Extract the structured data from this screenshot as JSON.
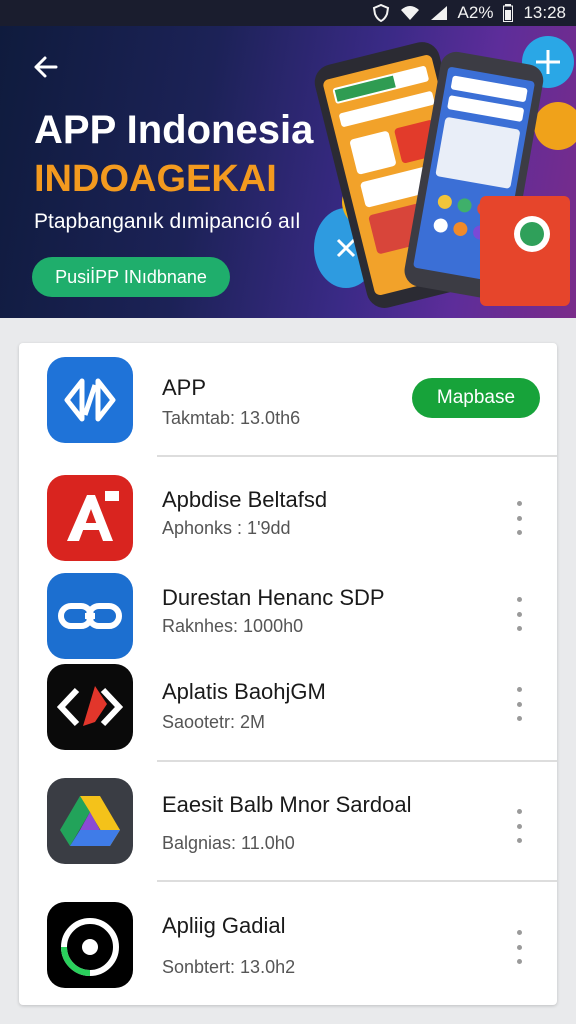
{
  "status_bar": {
    "battery_percent": "A2%",
    "time": "13:28",
    "icons": [
      "shield-icon",
      "wifi-icon",
      "signal-icon",
      "battery-icon"
    ]
  },
  "banner": {
    "title": "APP Indonesia",
    "subtitle": "INDOAGEKAI",
    "description": "Ptapbanganık dımipancıó aıl",
    "button_label": "PusiİPP INıdbnane",
    "colors": {
      "title": "#ffffff",
      "subtitle": "#f39a1f",
      "button": "#1fae6c"
    }
  },
  "apps": [
    {
      "name": "APP",
      "meta": "Takmtab: 13.0th6",
      "icon": "app-logo-icon",
      "action": "Mapbase"
    },
    {
      "name": "Apbdise Beltafsd",
      "meta": "Aphonks : 1'9dd",
      "icon": "letter-a-icon"
    },
    {
      "name": "Durestan Henanc SDP",
      "meta": "Raknhes: 1000h0",
      "icon": "chain-link-icon"
    },
    {
      "name": "Aplatis BaohjGM",
      "meta": "Saootetr: 2M",
      "icon": "code-brackets-icon"
    },
    {
      "name": "Eaesit Balb Mnor Sardoal",
      "meta": "Balgnias: 11.0h0",
      "icon": "drive-triangle-icon"
    },
    {
      "name": "Apliig Gadial",
      "meta": "Sonbtert: 13.0h2",
      "icon": "disc-icon"
    }
  ],
  "colors": {
    "accent_green": "#17a33a",
    "card_bg": "#ffffff",
    "page_bg": "#e9eaec"
  }
}
